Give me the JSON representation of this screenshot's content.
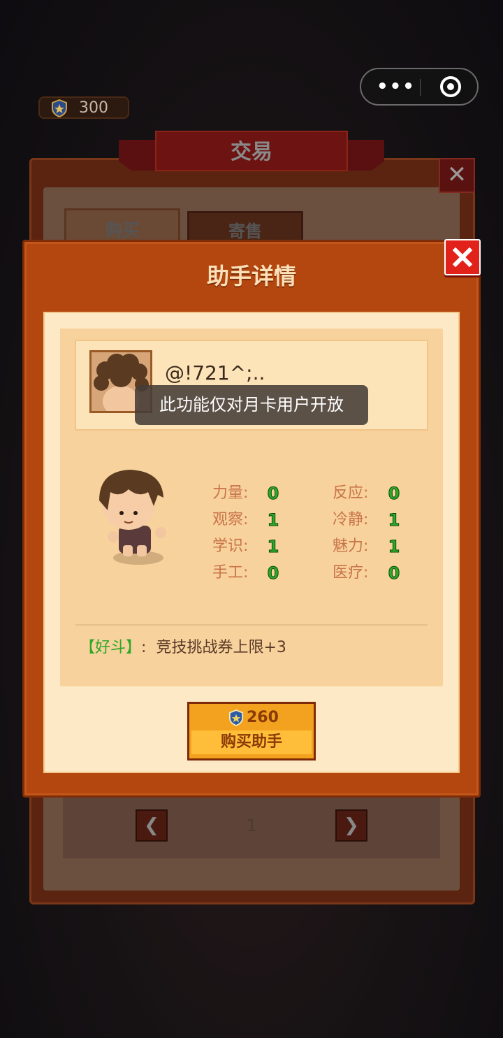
{
  "top_bar": {
    "currency_value": "300",
    "menu_more_glyph": "•••",
    "capsule_icons": [
      "more-dots-icon",
      "target-icon"
    ]
  },
  "trade_panel": {
    "title": "交易",
    "tabs": [
      "购买",
      "寄售"
    ],
    "page_number": "1",
    "prev_glyph": "❮",
    "next_glyph": "❯",
    "close_glyph": "✕"
  },
  "helper_detail": {
    "title": "助手详情",
    "username": "@!721^;..",
    "toast": "此功能仅对月卡用户开放",
    "stats_left": [
      {
        "label": "力量:",
        "value": "0"
      },
      {
        "label": "观察:",
        "value": "1"
      },
      {
        "label": "学识:",
        "value": "1"
      },
      {
        "label": "手工:",
        "value": "0"
      }
    ],
    "stats_right": [
      {
        "label": "反应:",
        "value": "0"
      },
      {
        "label": "冷静:",
        "value": "1"
      },
      {
        "label": "魅力:",
        "value": "1"
      },
      {
        "label": "医疗:",
        "value": "0"
      }
    ],
    "trait_name": "【好斗】",
    "trait_colon": ":",
    "trait_desc": "竞技挑战券上限+3",
    "buy_price": "260",
    "buy_label": "购买助手"
  },
  "colors": {
    "modal_orange": "#b3470f",
    "close_red": "#e2221a",
    "stat_green": "#2fa82a",
    "buy_button": "#f2a21e"
  }
}
